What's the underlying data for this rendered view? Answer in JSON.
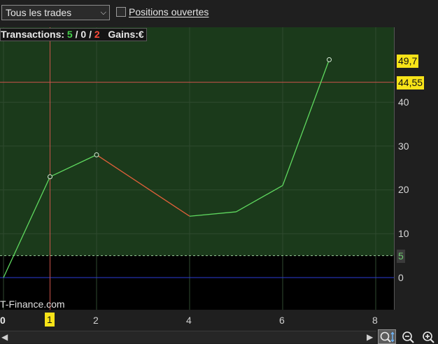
{
  "toolbar": {
    "filter_select_value": "Tous les trades",
    "open_positions_label": "Positions ouvertes",
    "open_positions_checked": false
  },
  "stats": {
    "label_transactions": "Transactions:",
    "wins": "5",
    "sep1": " / ",
    "neutral": "0",
    "sep2": " / ",
    "losses": "2",
    "label_gains": "Gains:",
    "gains_unit": "€"
  },
  "watermark": "T-Finance.com",
  "y_axis": {
    "ticks": [
      "0",
      "10",
      "20",
      "30",
      "40"
    ],
    "current_value_tag": "49,7",
    "crosshair_value_tag": "44,55",
    "threshold_tag": "5"
  },
  "x_axis": {
    "ticks": [
      "0",
      "2",
      "4",
      "6",
      "8"
    ],
    "crosshair_tag": "1"
  },
  "colors": {
    "plot_positive_bg": "#1b3a1b",
    "plot_negative_bg": "#000000",
    "rising_line": "#5fd95f",
    "falling_line": "#e0603a",
    "crosshair": "#c9534a",
    "zero_line": "#2b3bd6",
    "tag_yellow": "#f7e318"
  },
  "chart_data": {
    "type": "line",
    "x": [
      0,
      1,
      2,
      4,
      5,
      6,
      7
    ],
    "y": [
      0,
      23,
      28,
      14,
      15,
      21,
      49.7
    ],
    "markers_at_x": [
      1,
      2,
      7
    ],
    "xlim": [
      0,
      8.5
    ],
    "ylim": [
      -7,
      56
    ],
    "threshold": 5,
    "crosshair": {
      "x": 1,
      "y": 44.55
    },
    "grid": true
  }
}
